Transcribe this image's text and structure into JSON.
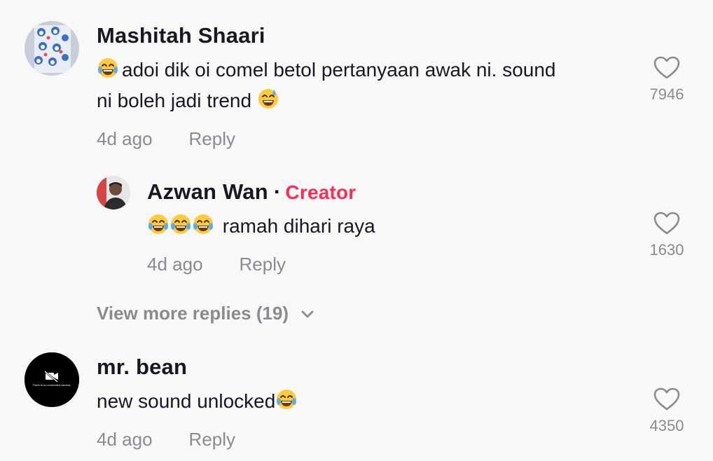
{
  "comments": [
    {
      "username": "Mashitah Shaari",
      "text_line1": "adoi dik oi comel betol pertanyaan awak ni. sound",
      "text_line2": "ni boleh jadi trend",
      "time": "4d ago",
      "reply_label": "Reply",
      "likes": "7946"
    },
    {
      "username": "Azwan Wan",
      "separator": "·",
      "badge": "Creator",
      "text": "ramah dihari raya",
      "time": "4d ago",
      "reply_label": "Reply",
      "likes": "1630"
    },
    {
      "username": "mr. bean",
      "avatar_caption": "There is no connected camera.",
      "text": "new sound unlocked",
      "time": "4d ago",
      "reply_label": "Reply",
      "likes": "4350"
    }
  ],
  "view_more": {
    "label": "View more replies (19)",
    "icon": "chevron-down-icon"
  },
  "colors": {
    "background": "#f8f8f8",
    "text": "#161823",
    "muted": "#8a8b91",
    "creator_accent": "#fe2c55"
  }
}
